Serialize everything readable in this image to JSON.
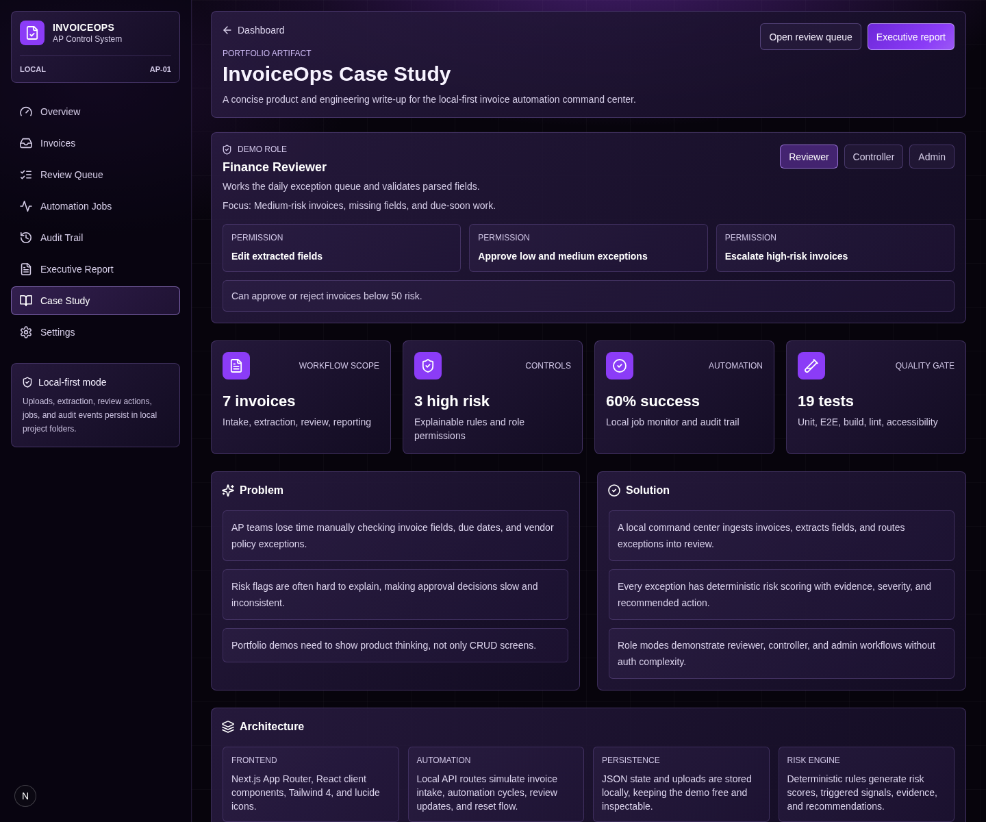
{
  "sidebar": {
    "brand": {
      "title": "INVOICEOPS",
      "subtitle": "AP Control System",
      "env": "LOCAL",
      "code": "AP-01"
    },
    "nav": [
      {
        "label": "Overview",
        "selected": false
      },
      {
        "label": "Invoices",
        "selected": false
      },
      {
        "label": "Review Queue",
        "selected": false
      },
      {
        "label": "Automation Jobs",
        "selected": false
      },
      {
        "label": "Audit Trail",
        "selected": false
      },
      {
        "label": "Executive Report",
        "selected": false
      },
      {
        "label": "Case Study",
        "selected": true
      },
      {
        "label": "Settings",
        "selected": false
      }
    ],
    "note": {
      "title": "Local-first mode",
      "text": "Uploads, extraction, review actions, jobs, and audit events persist in local project folders."
    }
  },
  "header": {
    "back": "Dashboard",
    "eyebrow": "PORTFOLIO ARTIFACT",
    "title": "InvoiceOps Case Study",
    "description": "A concise product and engineering write-up for the local-first invoice automation command center.",
    "actions": [
      {
        "label": "Open review queue",
        "kind": "secondary"
      },
      {
        "label": "Executive report",
        "kind": "primary"
      }
    ]
  },
  "role": {
    "eyebrow": "DEMO ROLE",
    "title": "Finance Reviewer",
    "description": "Works the daily exception queue and validates parsed fields.",
    "focus": "Focus: Medium-risk invoices, missing fields, and due-soon work.",
    "options": [
      {
        "label": "Reviewer",
        "selected": true
      },
      {
        "label": "Controller",
        "selected": false
      },
      {
        "label": "Admin",
        "selected": false
      }
    ],
    "permissions": [
      {
        "label": "PERMISSION",
        "value": "Edit extracted fields"
      },
      {
        "label": "PERMISSION",
        "value": "Approve low and medium exceptions"
      },
      {
        "label": "PERMISSION",
        "value": "Escalate high-risk invoices"
      }
    ],
    "note": "Can approve or reject invoices below 50 risk."
  },
  "stats": [
    {
      "label": "WORKFLOW SCOPE",
      "value": "7 invoices",
      "detail": "Intake, extraction, review, reporting"
    },
    {
      "label": "CONTROLS",
      "value": "3 high risk",
      "detail": "Explainable rules and role permissions"
    },
    {
      "label": "AUTOMATION",
      "value": "60% success",
      "detail": "Local job monitor and audit trail"
    },
    {
      "label": "QUALITY GATE",
      "value": "19 tests",
      "detail": "Unit, E2E, build, lint, accessibility"
    }
  ],
  "problem": {
    "title": "Problem",
    "items": [
      "AP teams lose time manually checking invoice fields, due dates, and vendor policy exceptions.",
      "Risk flags are often hard to explain, making approval decisions slow and inconsistent.",
      "Portfolio demos need to show product thinking, not only CRUD screens."
    ]
  },
  "solution": {
    "title": "Solution",
    "items": [
      "A local command center ingests invoices, extracts fields, and routes exceptions into review.",
      "Every exception has deterministic risk scoring with evidence, severity, and recommended action.",
      "Role modes demonstrate reviewer, controller, and admin workflows without auth complexity."
    ]
  },
  "architecture": {
    "title": "Architecture",
    "items": [
      {
        "label": "FRONTEND",
        "text": "Next.js App Router, React client components, Tailwind 4, and lucide icons."
      },
      {
        "label": "AUTOMATION",
        "text": "Local API routes simulate invoice intake, automation cycles, review updates, and reset flow."
      },
      {
        "label": "PERSISTENCE",
        "text": "JSON state and uploads are stored locally, keeping the demo free and inspectable."
      },
      {
        "label": "RISK ENGINE",
        "text": "Deterministic rules generate risk scores, triggered signals, evidence, and recommendations."
      }
    ]
  },
  "dev_badge": "N"
}
